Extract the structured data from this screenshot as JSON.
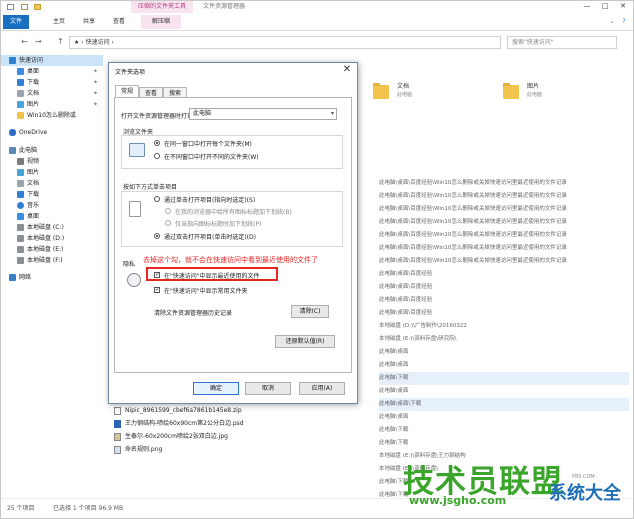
{
  "window": {
    "context_tab": "压缩的文件夹工具",
    "title": "文件资源管理器",
    "controls": {
      "minimize": "—",
      "maximize": "□",
      "close": "✕"
    }
  },
  "ribbon": {
    "tabs": [
      "文件",
      "主页",
      "共享",
      "查看"
    ],
    "manage_tab": "解压缩"
  },
  "nav": {
    "back": "←",
    "forward": "→",
    "up": "↑",
    "address": "★ › 快速访问 ›",
    "search_placeholder": "搜索\"快速访问\""
  },
  "sidebar": {
    "items": [
      {
        "label": "快速访问",
        "pinned": false
      },
      {
        "label": "桌面",
        "pinned": true
      },
      {
        "label": "下载",
        "pinned": true
      },
      {
        "label": "文档",
        "pinned": true
      },
      {
        "label": "图片",
        "pinned": true
      },
      {
        "label": "Win10怎么删除或",
        "pinned": false
      },
      {
        "label": "OneDrive",
        "pinned": false
      },
      {
        "label": "此电脑",
        "pinned": false
      },
      {
        "label": "视频",
        "pinned": false
      },
      {
        "label": "图片",
        "pinned": false
      },
      {
        "label": "文档",
        "pinned": false
      },
      {
        "label": "下载",
        "pinned": false
      },
      {
        "label": "音乐",
        "pinned": false
      },
      {
        "label": "桌面",
        "pinned": false
      },
      {
        "label": "本地磁盘 (C:)",
        "pinned": false
      },
      {
        "label": "本地磁盘 (D:)",
        "pinned": false
      },
      {
        "label": "本地磁盘 (E:)",
        "pinned": false
      },
      {
        "label": "本地磁盘 (F:)",
        "pinned": false
      },
      {
        "label": "网络",
        "pinned": false
      }
    ]
  },
  "content": {
    "folders": [
      {
        "name": "文档",
        "sub": "此电脑"
      },
      {
        "name": "图片",
        "sub": "此电脑"
      }
    ],
    "paths": [
      "此电脑\\桌面\\百度经验\\Win10怎么删除或关掉快速访问里最近使用的文件记录",
      "此电脑\\桌面\\百度经验\\Win10怎么删除或关掉快速访问里最近使用的文件记录",
      "此电脑\\桌面\\百度经验\\Win10怎么删除或关掉快速访问里最近使用的文件记录",
      "此电脑\\桌面\\百度经验\\Win10怎么删除或关掉快速访问里最近使用的文件记录",
      "此电脑\\桌面\\百度经验\\Win10怎么删除或关掉快速访问里最近使用的文件记录",
      "此电脑\\桌面\\百度经验\\Win10怎么删除或关掉快速访问里最近使用的文件记录",
      "此电脑\\桌面\\百度经验\\Win10怎么删除或关掉快速访问里最近使用的文件记录",
      "此电脑\\桌面\\百度经验",
      "此电脑\\桌面\\百度经验",
      "此电脑\\桌面\\百度经验",
      "此电脑\\桌面\\百度经验",
      "本地磁盘 (D:)\\广告制作\\20160322",
      "本地磁盘 (E:)\\资料存盘\\研究院\\",
      "此电脑\\桌面",
      "此电脑\\桌面",
      "此电脑\\下载",
      "此电脑\\桌面",
      "此电脑\\桌面\\下载",
      "此电脑\\桌面",
      "此电脑\\下载",
      "此电脑\\下载",
      "本地磁盘 (E:)\\资料存盘\\王力钢结构",
      "本地磁盘 (E:)\\资料存盘\\",
      "此电脑\\下载",
      "此电脑\\下载"
    ],
    "selected_path_indexes": [
      15,
      17
    ],
    "files": [
      "Nipic_8961599_cbef6a7861b145e8.zip",
      "王力钢结构-喷绘60x90cm第2公分白边.psd",
      "生泰尔-60x200cm喷绘2张双白边.jpg",
      "命名规则.png"
    ]
  },
  "status": {
    "count": "25 个项目",
    "selection": "已选择 1 个项目 96.9 MB"
  },
  "dialog": {
    "title": "文件夹选项",
    "close": "✕",
    "tabs": [
      "常规",
      "查看",
      "搜索"
    ],
    "open_label": "打开文件资源管理器时打开:",
    "open_value": "此电脑",
    "browse_group": "浏览文件夹",
    "browse_same": "在同一窗口中打开每个文件夹(M)",
    "browse_new": "在不同窗口中打开不同的文件夹(W)",
    "click_group": "按如下方式单击项目",
    "click_single": "通过单击打开项目(指向时选定)(S)",
    "underline_browser": "在我的浏览器中给所有图标标题加下划线(B)",
    "underline_hover": "仅当指向图标标题时加下划线(P)",
    "click_double": "通过双击打开项目(单击时选定)(D)",
    "privacy_group": "隐私",
    "show_recent": "在\"快速访问\"中显示最近使用的文件",
    "show_frequent": "在\"快速访问\"中显示常用文件夹",
    "clear_label": "清除文件资源管理器历史记录",
    "clear_button": "清除(C)",
    "restore_button": "还原默认值(R)",
    "ok_button": "确定",
    "cancel_button": "取消",
    "apply_button": "应用(A)",
    "annotation": "去掉这个勾，就不会在快速访问中看到最近使用的文件了"
  },
  "watermark": {
    "brand": "技术员联盟",
    "url": "www.jsgho.com",
    "sub": "系统大全",
    "site": "P85.COM"
  },
  "colors": {
    "accent": "#1a6fc0",
    "annotation": "#e52424",
    "watermark_green": "#3aa52a",
    "watermark_blue": "#1f6fb8",
    "context_tab": "#f7e4f0"
  }
}
